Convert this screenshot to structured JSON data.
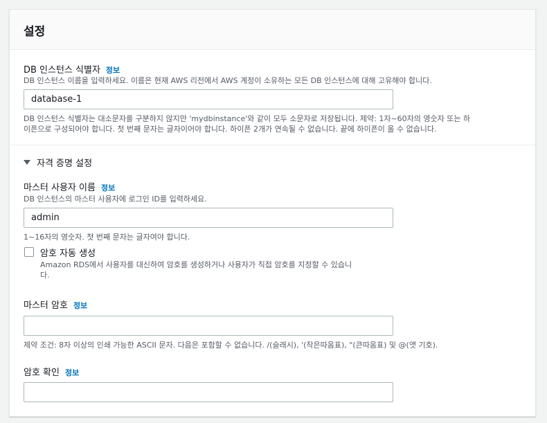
{
  "panel": {
    "title": "설정"
  },
  "info_label": "정보",
  "db_identifier": {
    "label": "DB 인스턴스 식별자",
    "description": "DB 인스턴스 이름을 입력하세요. 이름은 현재 AWS 리전에서 AWS 계정이 소유하는 모든 DB 인스턴스에 대해 고유해야 합니다.",
    "value": "database-1",
    "constraint_line1": "DB 인스턴스 식별자는 대소문자를 구분하지 않지만 'mydbinstance'와 같이 모두 소문자로 저장됩니다. 제약: 1자~60자의 영숫자 또는 하",
    "constraint_line2": "이픈으로 구성되어야 합니다. 첫 번째 문자는 글자이어야 합니다. 하이픈 2개가 연속될 수 없습니다. 끝에 하이픈이 올 수 없습니다."
  },
  "credentials": {
    "section_label": "자격 증명 설정",
    "expanded": true,
    "master_username": {
      "label": "마스터 사용자 이름",
      "description": "DB 인스턴스의 마스터 사용자에 로그인 ID를 입력하세요.",
      "value": "admin",
      "constraint": "1~16자의 영숫자. 첫 번째 문자는 글자여야 합니다."
    },
    "auto_password": {
      "label": "암호 자동 생성",
      "checked": false,
      "description_line1": "Amazon RDS에서 사용자를 대신하여 암호를 생성하거나 사용자가 직접 암호를 지정할 수 있습니",
      "description_line2": "다."
    },
    "master_password": {
      "label": "마스터 암호",
      "value": "",
      "constraint": "제약 조건: 8자 이상의 인쇄 가능한 ASCII 문자. 다음은 포함할 수 없습니다. /(슬래시), '(작은따옴표), \"(큰따옴표) 및 @(앳 기호)."
    },
    "confirm_password": {
      "label": "암호 확인",
      "value": ""
    }
  },
  "colors": {
    "link": "#0073bb",
    "text": "#16191f",
    "muted": "#545b64",
    "border": "#aab7b8",
    "background": "#f2f3f3"
  }
}
